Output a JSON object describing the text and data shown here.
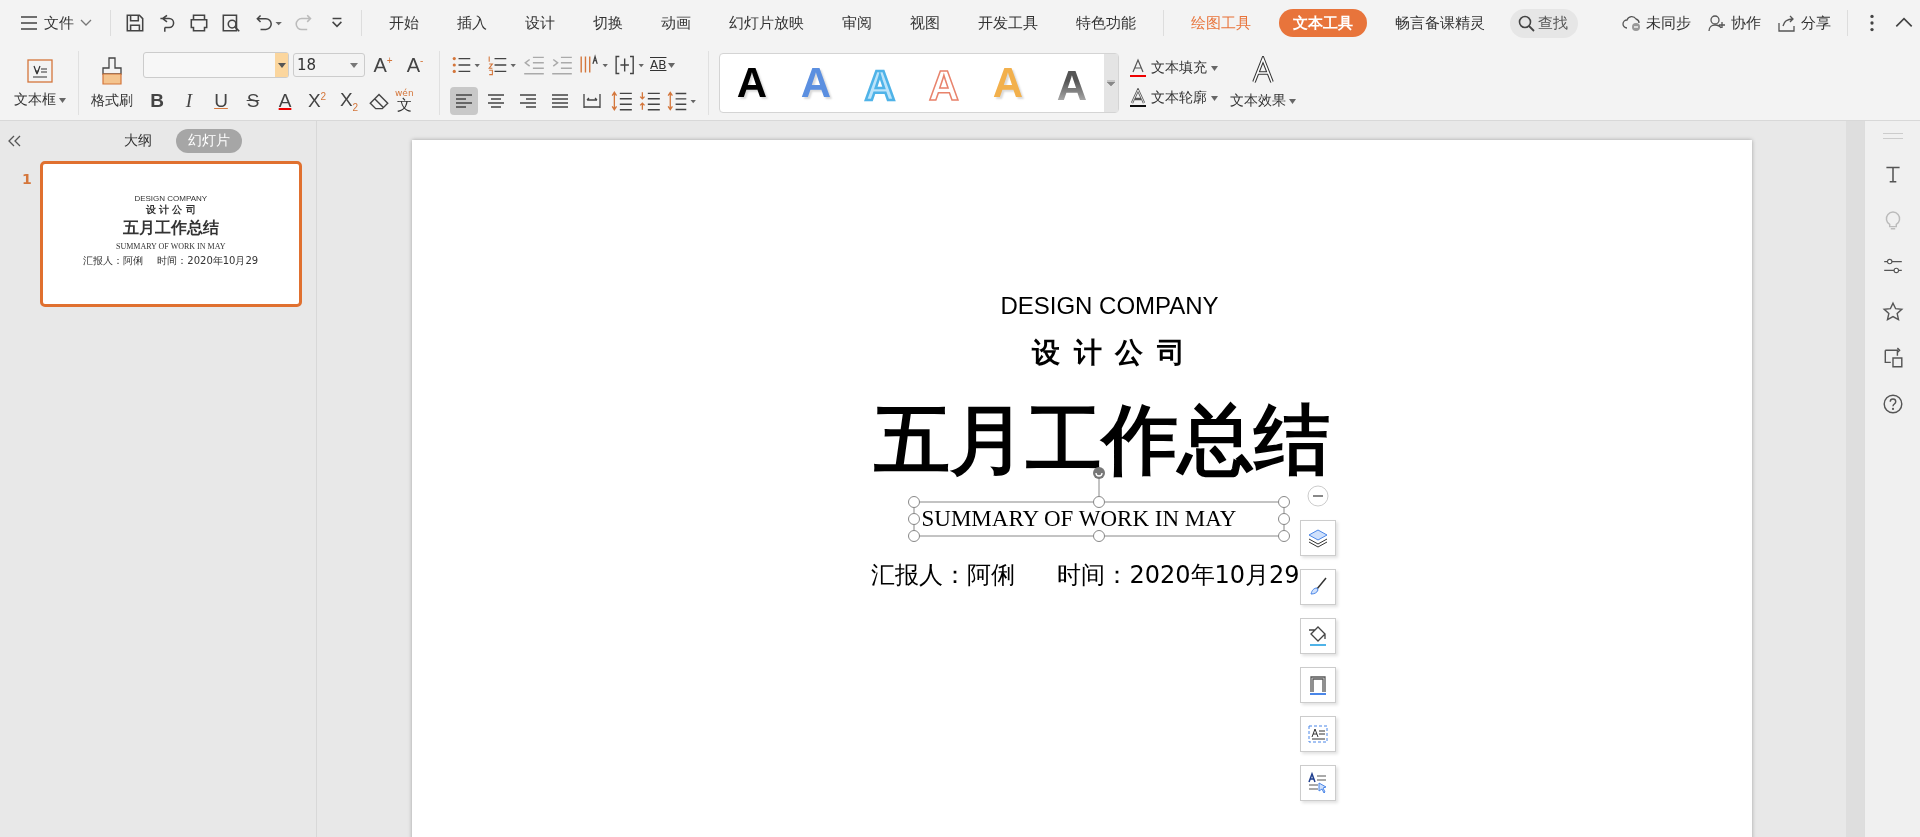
{
  "menu": {
    "file": "文件",
    "tabs": [
      {
        "label": "开始",
        "kind": "normal",
        "selected": false
      },
      {
        "label": "插入",
        "kind": "normal",
        "selected": false
      },
      {
        "label": "设计",
        "kind": "normal",
        "selected": false
      },
      {
        "label": "切换",
        "kind": "normal",
        "selected": false
      },
      {
        "label": "动画",
        "kind": "normal",
        "selected": false
      },
      {
        "label": "幻灯片放映",
        "kind": "normal",
        "selected": false
      },
      {
        "label": "审阅",
        "kind": "normal",
        "selected": false
      },
      {
        "label": "视图",
        "kind": "normal",
        "selected": false
      },
      {
        "label": "开发工具",
        "kind": "normal",
        "selected": false
      },
      {
        "label": "特色功能",
        "kind": "normal",
        "selected": false
      },
      {
        "label": "绘图工具",
        "kind": "context",
        "selected": false
      },
      {
        "label": "文本工具",
        "kind": "context",
        "selected": true
      },
      {
        "label": "畅言备课精灵",
        "kind": "normal",
        "selected": false
      }
    ],
    "search": {
      "placeholder": "查找"
    },
    "actions": [
      {
        "label": "未同步",
        "kind": "cloud"
      },
      {
        "label": "协作",
        "kind": "user"
      },
      {
        "label": "分享",
        "kind": "share"
      }
    ]
  },
  "ribbon": {
    "textbox": "文本框",
    "format_painter": "格式刷",
    "font_size": "18",
    "size_buttons": [
      "A$^{+}$",
      "A$^{-}$"
    ],
    "format_buttons": [
      {
        "label": "B",
        "kind": "bold"
      },
      {
        "label": "I",
        "kind": "italic"
      },
      {
        "label": "U",
        "kind": "underline"
      },
      {
        "label": "S",
        "kind": "strike"
      },
      {
        "label": "A",
        "kind": "color"
      },
      {
        "label": "X$^{2}$",
        "kind": "plain"
      },
      {
        "label": "X$_{2}$",
        "kind": "plain"
      }
    ],
    "phonetic": {
      "ruby": "wén",
      "label": "文"
    },
    "columns_label": "AB",
    "align": [
      {
        "kind": "left",
        "selected": true
      },
      {
        "kind": "center",
        "selected": false
      },
      {
        "kind": "right",
        "selected": false
      },
      {
        "kind": "justify",
        "selected": false
      },
      {
        "kind": "distributed",
        "selected": false
      }
    ],
    "styles": [
      {
        "label": "A",
        "kind": "solid",
        "color": "#000000"
      },
      {
        "label": "A",
        "kind": "solid",
        "color": "#5b8fe0"
      },
      {
        "label": "A",
        "kind": "light",
        "color": "#bde4fa"
      },
      {
        "label": "A",
        "kind": "outline",
        "color": "#ffffff"
      },
      {
        "label": "A",
        "kind": "solid",
        "color": "#f2b04c"
      },
      {
        "label": "A",
        "kind": "gradient",
        "color": "#555555"
      }
    ],
    "text_fill": "文本填充",
    "text_outline": "文本轮廓",
    "text_effects": "文本效果"
  },
  "panel": {
    "tabs": [
      {
        "label": "大纲",
        "selected": false
      },
      {
        "label": "幻灯片",
        "selected": true
      }
    ],
    "slides": [
      {
        "number": "1",
        "selected": true,
        "company_en": "DESIGN COMPANY",
        "company_cn": "设 计 公 司",
        "title": "五月工作总结",
        "subtitle": "SUMMARY OF WORK IN MAY",
        "reporter": "汇报人：阿俐",
        "time": "时间：2020年10月29"
      }
    ]
  },
  "slide": {
    "company_en": "DESIGN COMPANY",
    "company_cn": "设 计 公 司",
    "title": "五月工作总结",
    "subtitle": "SUMMARY OF WORK IN MAY",
    "reporter": "汇报人：阿俐",
    "time": "时间：2020年10月29"
  }
}
